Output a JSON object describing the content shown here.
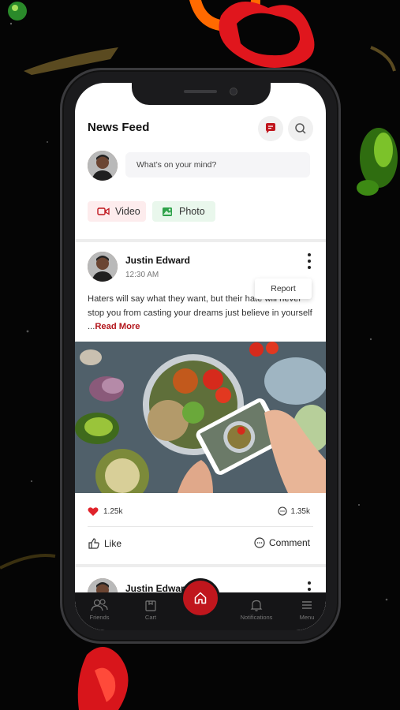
{
  "feed": {
    "title": "News Feed",
    "compose_placeholder": "What’s on your mind?",
    "video_label": "Video",
    "photo_label": "Photo"
  },
  "post": {
    "author": "Justin Edward",
    "time": "12:30 AM",
    "menu_option": "Report",
    "text": "Haters will say what they want, but their hate will never stop you from casting your dreams just believe in yourself ...",
    "read_more": "Read More",
    "likes": "1.25k",
    "comments": "1.35k",
    "like_label": "Like",
    "comment_label": "Comment"
  },
  "next_post": {
    "author": "Justin Edward"
  },
  "tabbar": {
    "friends": "Friends",
    "cart": "Cart",
    "notifications": "Notifications",
    "menu": "Menu"
  },
  "colors": {
    "accent": "#c0161d",
    "background": "#050505",
    "tabbar": "#151517"
  },
  "icons": [
    "chat-icon",
    "search-icon",
    "video-icon",
    "image-icon",
    "more-vertical-icon",
    "heart-icon",
    "comment-icon",
    "thumbs-up-icon",
    "friends-icon",
    "cart-icon",
    "home-icon",
    "bell-icon",
    "menu-icon"
  ]
}
